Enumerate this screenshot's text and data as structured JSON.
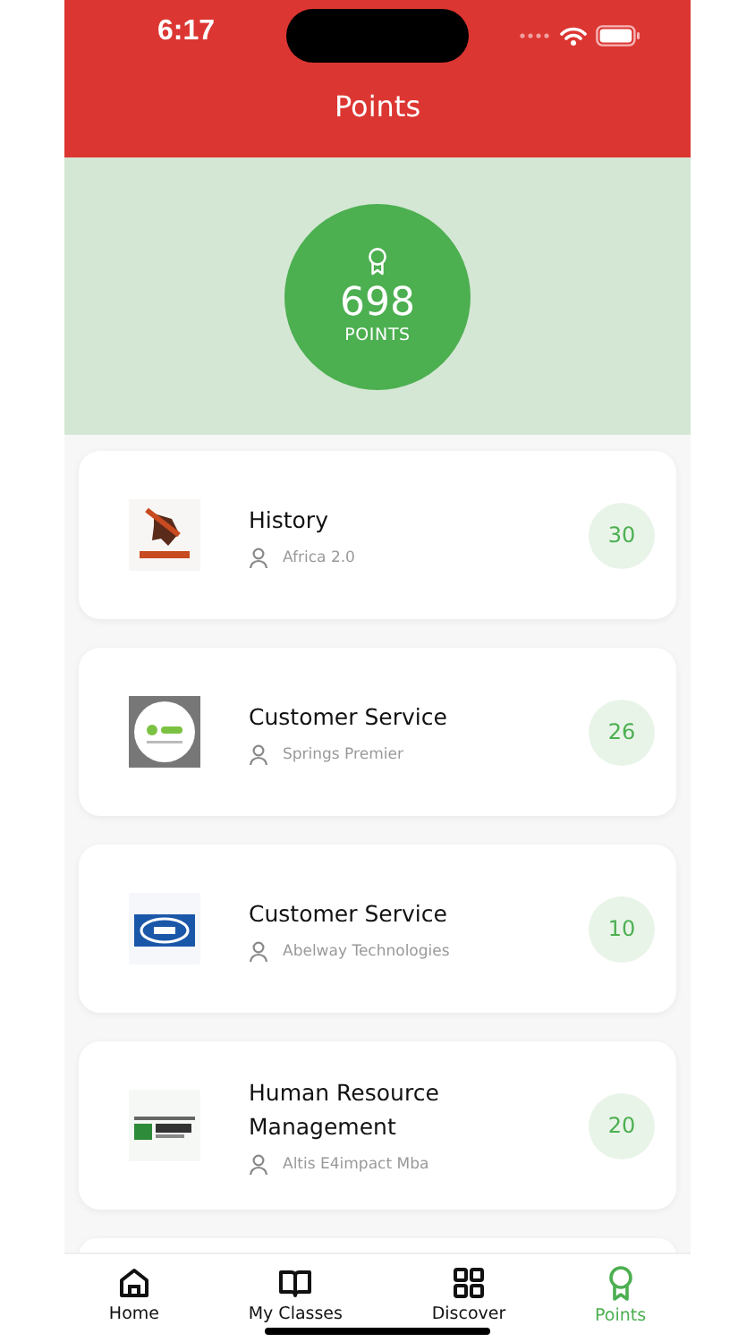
{
  "status_bar": {
    "time": "6:17"
  },
  "header": {
    "title": "Points"
  },
  "summary": {
    "points": "698",
    "label": "POINTS"
  },
  "classes": [
    {
      "title": "History",
      "instructor": "Africa 2.0",
      "points": "30"
    },
    {
      "title": "Customer Service",
      "instructor": "Springs Premier",
      "points": "26"
    },
    {
      "title": "Customer Service",
      "instructor": "Abelway Technologies",
      "points": "10"
    },
    {
      "title": "Human Resource Management",
      "instructor": "Altis E4impact Mba",
      "points": "20"
    }
  ],
  "tab_bar": [
    {
      "label": "Home",
      "selected": false
    },
    {
      "label": "My Classes",
      "selected": false
    },
    {
      "label": "Discover",
      "selected": false
    },
    {
      "label": "Points",
      "selected": true
    }
  ]
}
